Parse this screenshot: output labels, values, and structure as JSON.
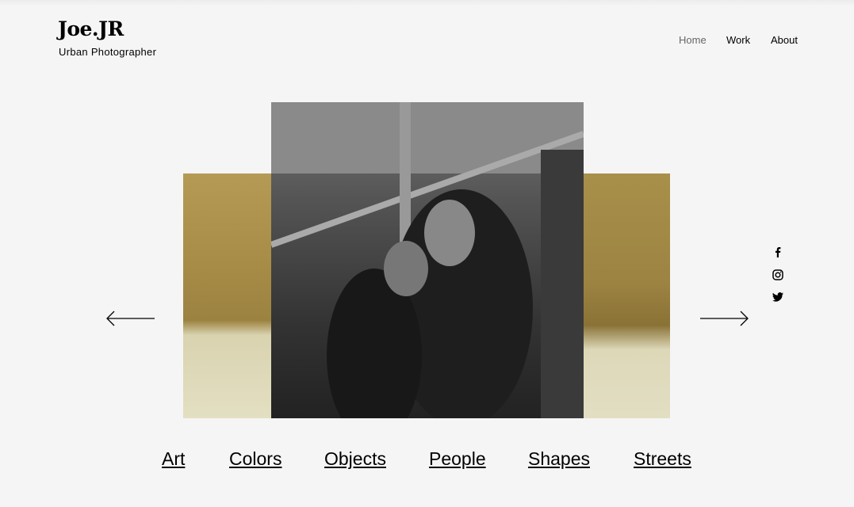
{
  "header": {
    "logo": "Joe.JR",
    "tagline": "Urban Photographer"
  },
  "nav": [
    {
      "label": "Home",
      "active": true
    },
    {
      "label": "Work"
    },
    {
      "label": "About"
    }
  ],
  "gallery": {
    "prev_icon": "arrow-left-icon",
    "next_icon": "arrow-right-icon"
  },
  "social": [
    "facebook-icon",
    "instagram-icon",
    "twitter-icon"
  ],
  "categories": [
    "Art",
    "Colors",
    "Objects",
    "People",
    "Shapes",
    "Streets"
  ]
}
